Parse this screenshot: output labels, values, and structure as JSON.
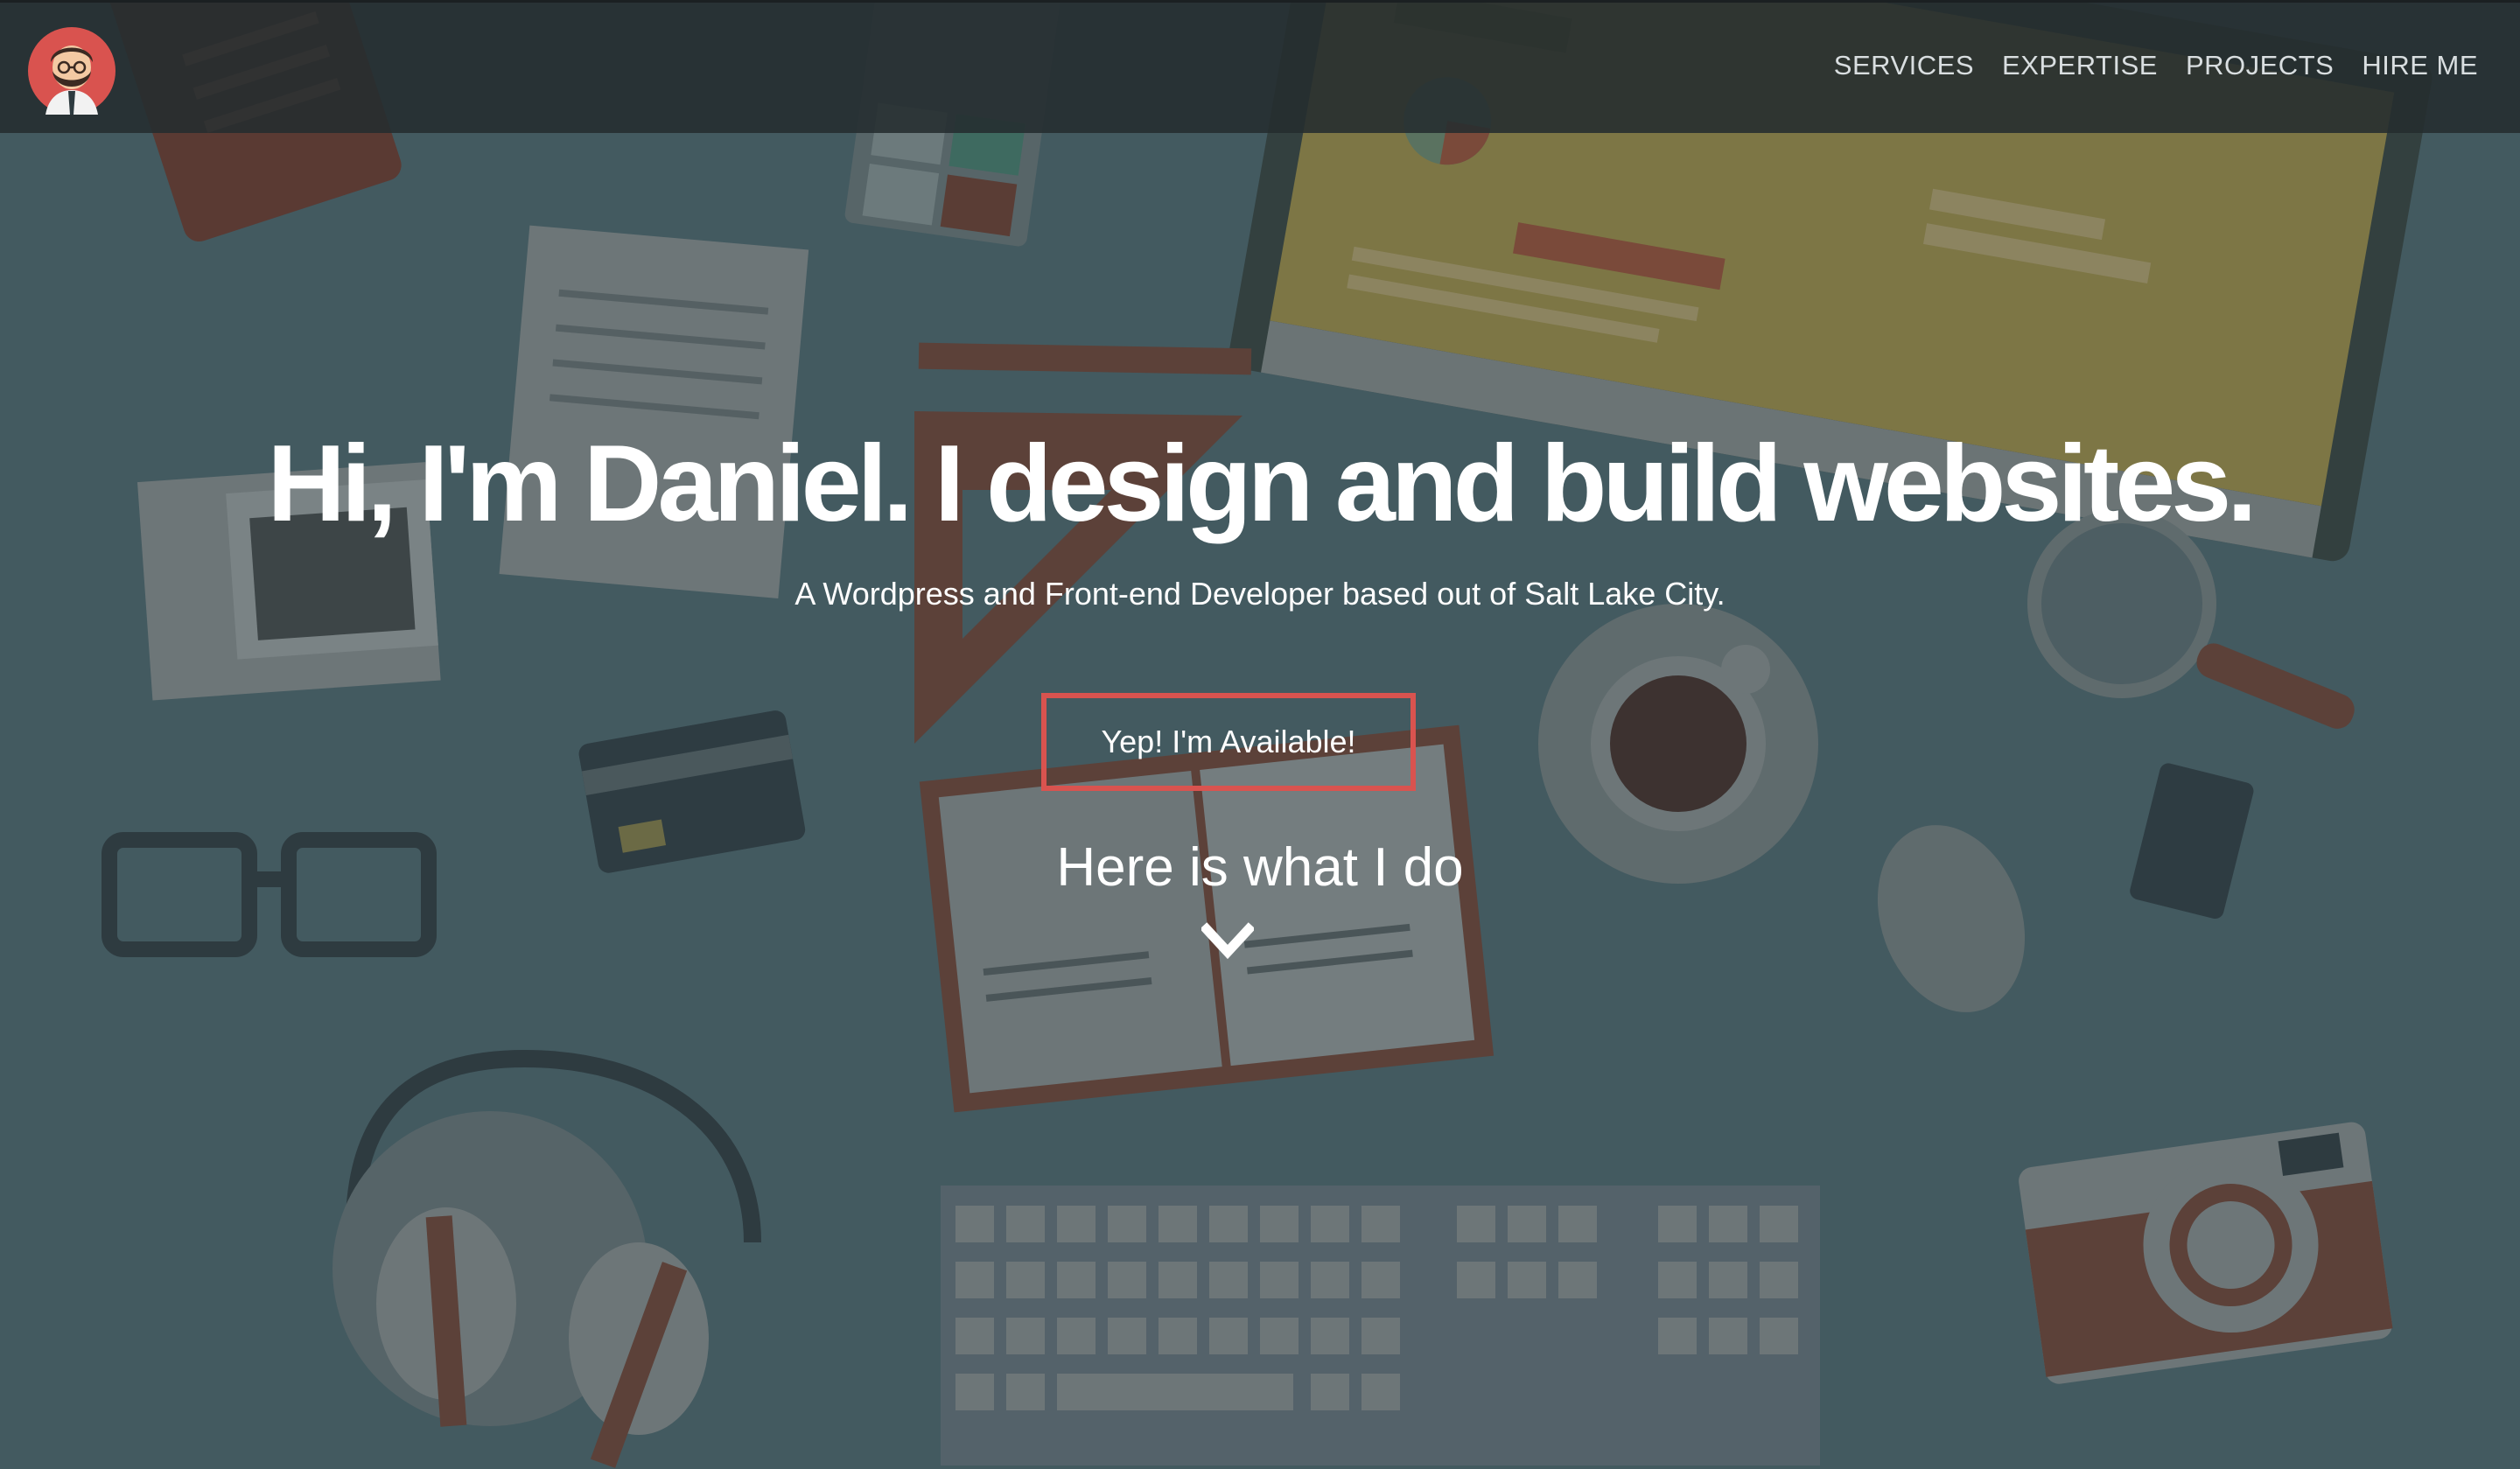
{
  "nav": {
    "avatar_icon": "developer-avatar-icon",
    "links": [
      "SERVICES",
      "EXPERTISE",
      "PROJECTS",
      "HIRE ME"
    ]
  },
  "hero": {
    "headline": "Hi, I'm Daniel. I design and build websites.",
    "subtitle": "A Wordpress and Front-end Developer based out of Salt Lake City.",
    "cta_label": "Yep! I'm Available!",
    "what_i_do": "Here is what I do",
    "scroll_icon": "chevron-down-icon"
  },
  "colors": {
    "accent": "#d9534f",
    "overlay": "#435a60",
    "navbar": "#242c2f",
    "text": "#ffffff"
  }
}
